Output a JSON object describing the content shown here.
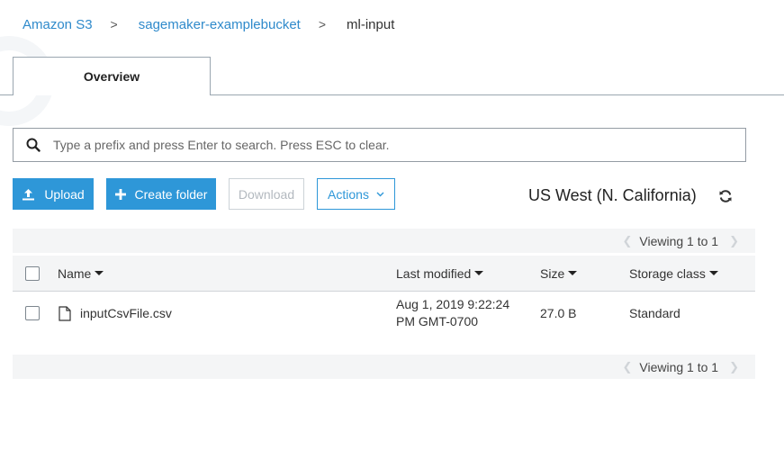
{
  "breadcrumb": {
    "items": [
      "Amazon S3",
      "sagemaker-examplebucket"
    ],
    "current": "ml-input",
    "separator": ">"
  },
  "tabs": [
    {
      "label": "Overview",
      "active": true
    }
  ],
  "search": {
    "placeholder": "Type a prefix and press Enter to search. Press ESC to clear.",
    "icon": "search-icon"
  },
  "toolbar": {
    "upload_label": "Upload",
    "create_folder_label": "Create folder",
    "download_label": "Download",
    "actions_label": "Actions",
    "region": "US West (N. California)"
  },
  "pagination": {
    "text": "Viewing 1 to 1"
  },
  "table": {
    "columns": [
      "Name",
      "Last modified",
      "Size",
      "Storage class"
    ],
    "rows": [
      {
        "name": "inputCsvFile.csv",
        "modified_line1": "Aug 1, 2019 9:22:24",
        "modified_line2": "PM GMT-0700",
        "size": "27.0 B",
        "storage_class": "Standard"
      }
    ]
  },
  "colors": {
    "accent": "#2e97d8",
    "link": "#2f8acb",
    "muted_bg": "#f4f5f6"
  }
}
